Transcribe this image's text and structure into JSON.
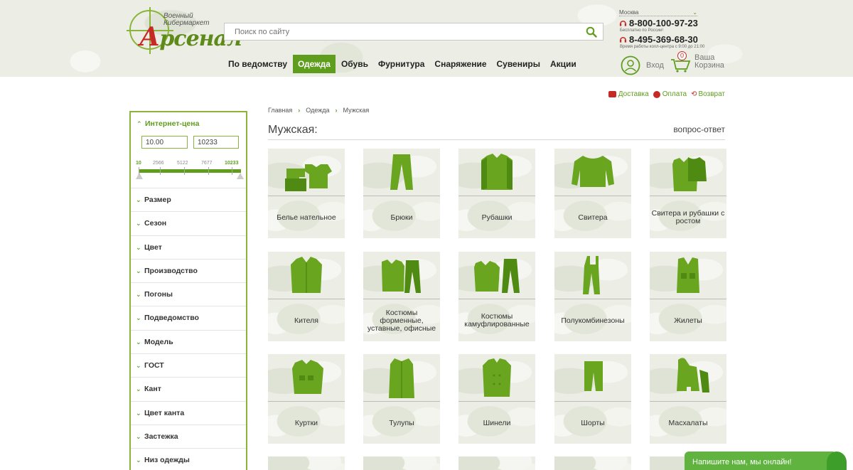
{
  "header": {
    "logo_small": "Военный\nКибермаркет",
    "logo_big_first": "А",
    "logo_big_rest": "рсенал",
    "search_placeholder": "Поиск по сайту",
    "nav": [
      "По ведомству",
      "Одежда",
      "Обувь",
      "Фурнитура",
      "Снаряжение",
      "Сувениры",
      "Акции"
    ],
    "nav_active": 1,
    "city": "Москва",
    "phone1": "8-800-100-97-23",
    "phone1_note": "Бесплатно по России!",
    "phone2": "8-495-369-68-30",
    "phone2_note": "Время работы колл-центра с 9:00 до 21:00",
    "login_label": "Вход",
    "cart_label_1": "Ваша",
    "cart_label_2": "Корзина",
    "cart_count": "0"
  },
  "services": {
    "delivery": "Доставка",
    "payment": "Оплата",
    "return": "Возврат"
  },
  "breadcrumbs": [
    "Главная",
    "Одежда",
    "Мужская"
  ],
  "page_title": "Мужская:",
  "faq_link": "вопрос-ответ",
  "filters": {
    "price_title": "Интернет-цена",
    "price_min": "10.00",
    "price_max": "10233",
    "scale": [
      "10",
      "2566",
      "5122",
      "7677",
      "10233"
    ],
    "items": [
      "Размер",
      "Сезон",
      "Цвет",
      "Производство",
      "Погоны",
      "Подведомство",
      "Модель",
      "ГОСТ",
      "Кант",
      "Цвет канта",
      "Застежка",
      "Низ одежды"
    ]
  },
  "categories": [
    {
      "name": "Белье нательное",
      "icon": "underwear-icon"
    },
    {
      "name": "Брюки",
      "icon": "trousers-icon"
    },
    {
      "name": "Рубашки",
      "icon": "shirt-icon"
    },
    {
      "name": "Свитера",
      "icon": "sweater-icon"
    },
    {
      "name": "Свитера и рубашки с ростом",
      "icon": "shirt-sweater-icon"
    },
    {
      "name": "Кителя",
      "icon": "tunic-icon"
    },
    {
      "name": "Костюмы форменные, уставные, офисные",
      "icon": "uniform-suit-icon"
    },
    {
      "name": "Костюмы камуфлированные",
      "icon": "camo-suit-icon"
    },
    {
      "name": "Полукомбинезоны",
      "icon": "overalls-icon"
    },
    {
      "name": "Жилеты",
      "icon": "vest-icon"
    },
    {
      "name": "Куртки",
      "icon": "jacket-icon"
    },
    {
      "name": "Тулупы",
      "icon": "sheepskin-coat-icon"
    },
    {
      "name": "Шинели",
      "icon": "greatcoat-icon"
    },
    {
      "name": "Шорты",
      "icon": "shorts-icon"
    },
    {
      "name": "Масхалаты",
      "icon": "camo-cloak-icon"
    }
  ],
  "chat_label": "Напишите нам, мы онлайн!",
  "colors": {
    "accent": "#5f9d1d",
    "brand_red": "#c62a25",
    "garment": "#6aa51f"
  }
}
